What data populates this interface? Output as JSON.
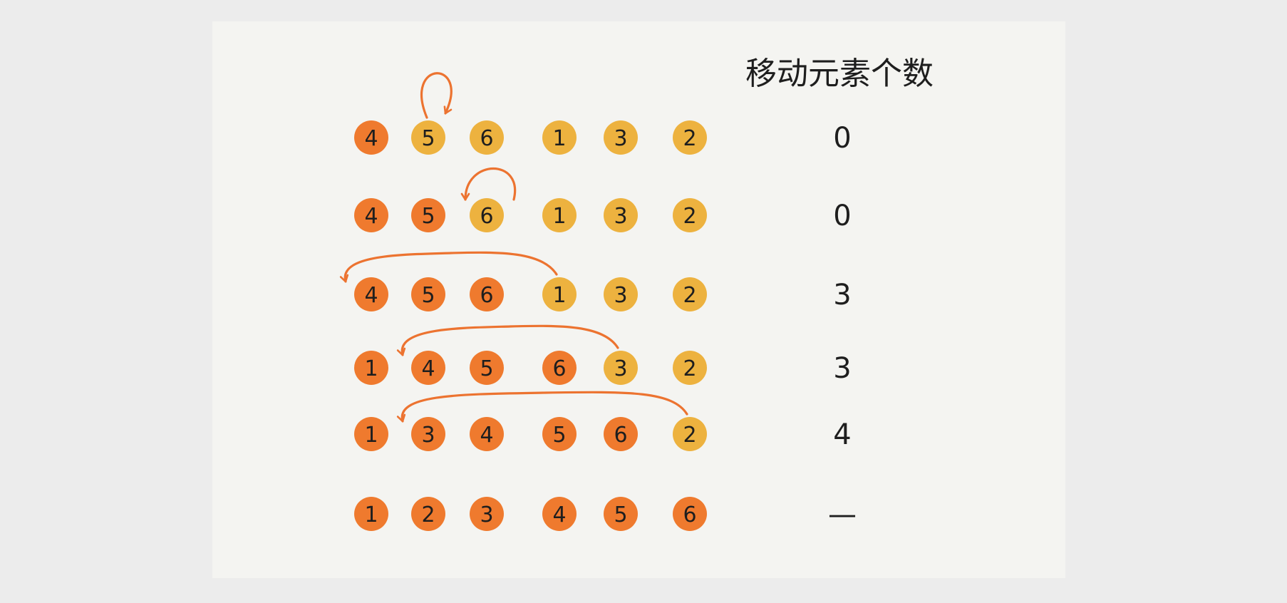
{
  "header": {
    "label": "移动元素个数"
  },
  "colors": {
    "page_background": "#ececec",
    "card_background": "#f4f4f1",
    "sorted": "#ef7a2e",
    "unsorted": "#edb23f",
    "arrow": "#ec7330",
    "ink": "#1e1e1e"
  },
  "steps": [
    {
      "values": [
        "4",
        "5",
        "6",
        "1",
        "3",
        "2"
      ],
      "sorted_count": 1,
      "move_count": "0",
      "insert": {
        "from": 1,
        "to": 1
      }
    },
    {
      "values": [
        "4",
        "5",
        "6",
        "1",
        "3",
        "2"
      ],
      "sorted_count": 2,
      "move_count": "0",
      "insert": {
        "from": 2,
        "to": 2
      }
    },
    {
      "values": [
        "4",
        "5",
        "6",
        "1",
        "3",
        "2"
      ],
      "sorted_count": 3,
      "move_count": "3",
      "insert": {
        "from": 3,
        "to": 0
      }
    },
    {
      "values": [
        "1",
        "4",
        "5",
        "6",
        "3",
        "2"
      ],
      "sorted_count": 4,
      "move_count": "3",
      "insert": {
        "from": 4,
        "to": 1
      }
    },
    {
      "values": [
        "1",
        "3",
        "4",
        "5",
        "6",
        "2"
      ],
      "sorted_count": 5,
      "move_count": "4",
      "insert": {
        "from": 5,
        "to": 1
      }
    },
    {
      "values": [
        "1",
        "2",
        "3",
        "4",
        "5",
        "6"
      ],
      "sorted_count": 6,
      "move_count": "—"
    }
  ]
}
